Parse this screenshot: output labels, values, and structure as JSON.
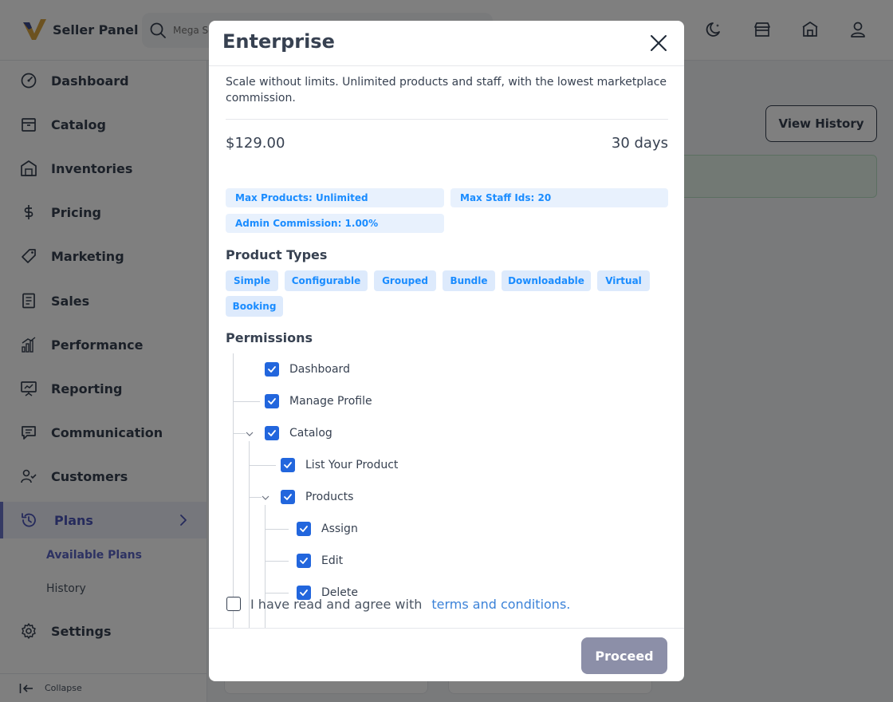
{
  "app": {
    "brand_name": "Seller Panel"
  },
  "search": {
    "placeholder": "Mega Search"
  },
  "sidebar": {
    "items": [
      {
        "name": "dashboard",
        "label": "Dashboard",
        "icon": "gauge-icon"
      },
      {
        "name": "catalog",
        "label": "Catalog",
        "icon": "box-icon"
      },
      {
        "name": "inventories",
        "label": "Inventories",
        "icon": "warehouse-icon"
      },
      {
        "name": "pricing",
        "label": "Pricing",
        "icon": "dollar-icon"
      },
      {
        "name": "marketing",
        "label": "Marketing",
        "icon": "tag-icon"
      },
      {
        "name": "sales",
        "label": "Sales",
        "icon": "document-icon"
      },
      {
        "name": "performance",
        "label": "Performance",
        "icon": "bar-chart-icon"
      },
      {
        "name": "reporting",
        "label": "Reporting",
        "icon": "presentation-icon"
      },
      {
        "name": "communication",
        "label": "Communication",
        "icon": "chat-icon"
      },
      {
        "name": "customers",
        "label": "Customers",
        "icon": "users-icon"
      },
      {
        "name": "plans",
        "label": "Plans",
        "icon": "history-icon",
        "active": true
      },
      {
        "name": "settings",
        "label": "Settings",
        "icon": "gear-icon"
      }
    ],
    "plans_submenu": {
      "available": "Available Plans",
      "history": "History"
    },
    "collapse_label": "Collapse"
  },
  "main": {
    "view_history_label": "View History"
  },
  "modal": {
    "title": "Enterprise",
    "description": "Scale without limits. Unlimited products and staff, with the lowest marketplace commission.",
    "price": "$129.00",
    "duration": "30 days",
    "chips": {
      "max_products": "Max Products: Unlimited",
      "max_staff": "Max Staff Ids: 20",
      "admin_commission": "Admin Commission: 1.00%"
    },
    "product_types_title": "Product Types",
    "product_types": [
      "Simple",
      "Configurable",
      "Grouped",
      "Bundle",
      "Downloadable",
      "Virtual",
      "Booking"
    ],
    "permissions_title": "Permissions",
    "permissions": [
      {
        "label": "Dashboard",
        "checked": true
      },
      {
        "label": "Manage Profile",
        "checked": true
      },
      {
        "label": "Catalog",
        "checked": true,
        "expanded": true
      },
      {
        "label": "List Your Product",
        "checked": true
      },
      {
        "label": "Products",
        "checked": true,
        "expanded": true
      },
      {
        "label": "Assign",
        "checked": true
      },
      {
        "label": "Edit",
        "checked": true
      },
      {
        "label": "Delete",
        "checked": true
      }
    ],
    "agree_text": "I have read and agree with",
    "terms_link": "terms and conditions.",
    "proceed_label": "Proceed"
  },
  "colors": {
    "accent": "#2266dd",
    "chip_text": "#1a8cff",
    "link": "#3b82d8",
    "proceed_disabled": "#8c8fa8",
    "brand_logo": "#d9a441"
  }
}
